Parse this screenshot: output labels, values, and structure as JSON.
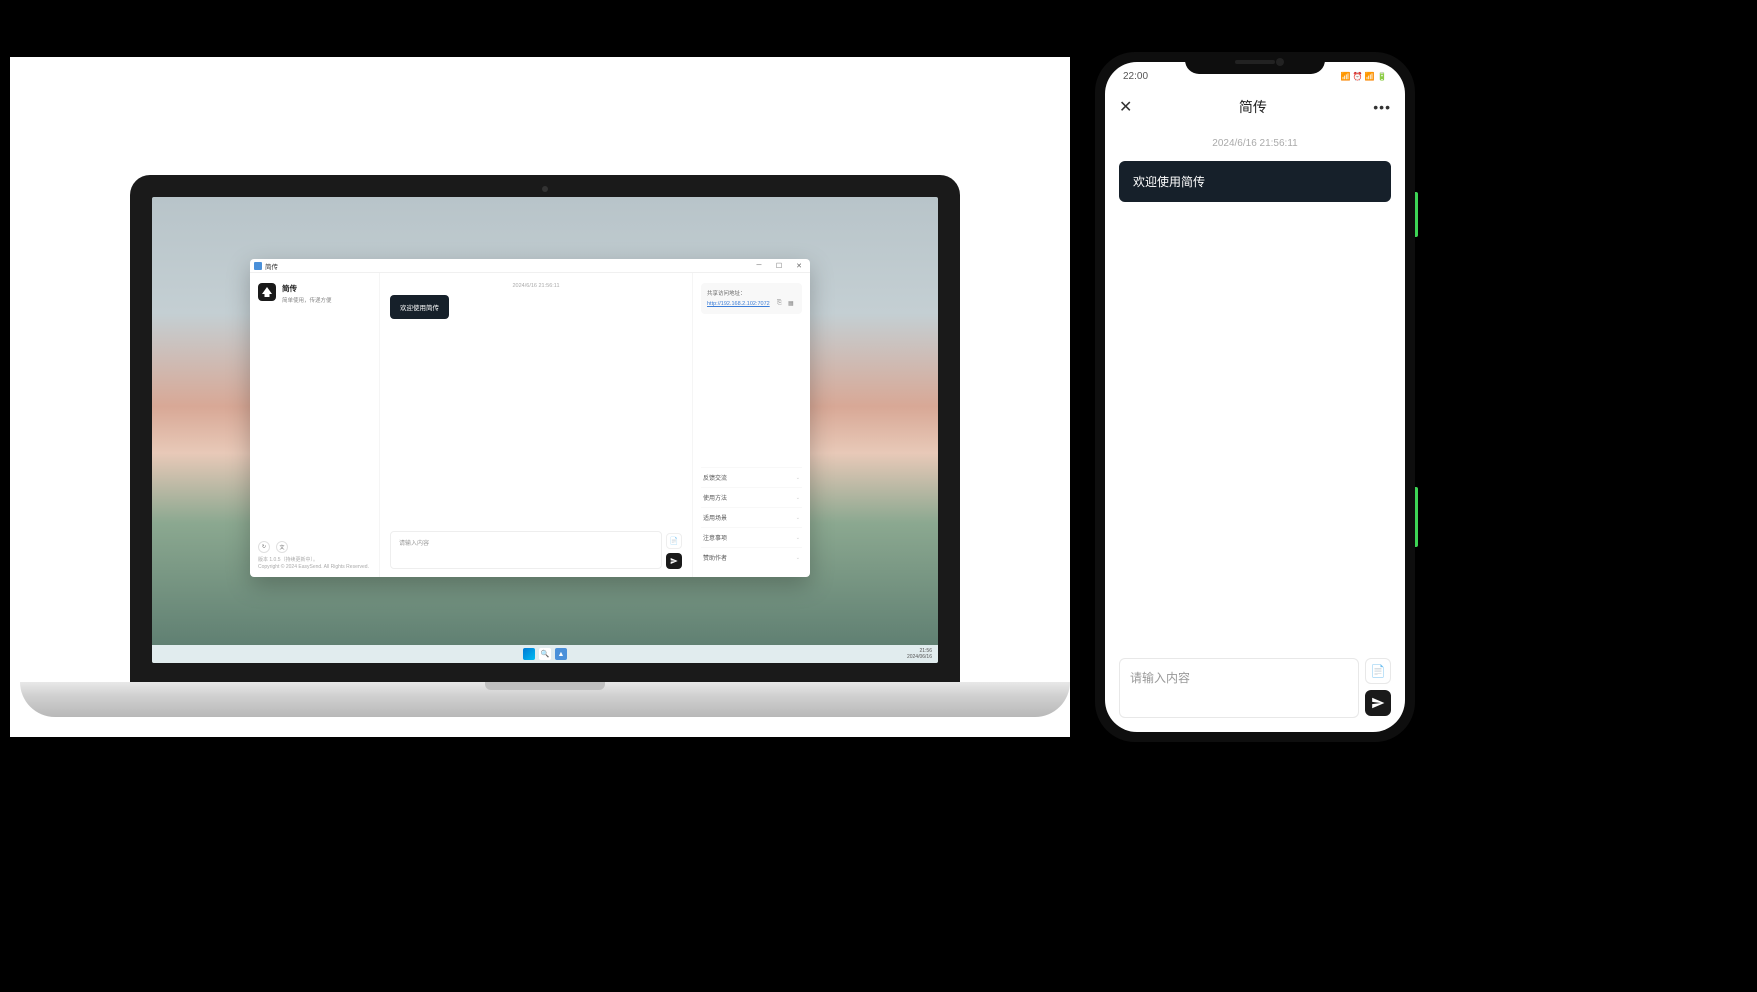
{
  "laptop": {
    "titlebar": {
      "title": "简传"
    },
    "sidebar": {
      "title": "简传",
      "subtitle": "简单使用，传递方便",
      "version_line": "版本 1.0.5（持续更新中）。",
      "copyright": "Copyright © 2024 EasySend. All Rights Reserved."
    },
    "main": {
      "timestamp": "2024/6/16 21:56:11",
      "welcome": "欢迎使用简传",
      "input_placeholder": "请输入内容"
    },
    "right": {
      "share_label": "共享访问地址：",
      "share_url": "http://192.168.2.102:7072",
      "accordion": [
        "反馈交流",
        "使用方法",
        "适用场景",
        "注意事项",
        "赞助作者"
      ]
    },
    "taskbar": {
      "time": "21:56",
      "date": "2024/06/16"
    }
  },
  "phone": {
    "status_time": "22:00",
    "status_icons": "📶 ⏰ 📶 🔋",
    "title": "简传",
    "timestamp": "2024/6/16 21:56:11",
    "welcome": "欢迎使用简传",
    "input_placeholder": "请输入内容"
  }
}
